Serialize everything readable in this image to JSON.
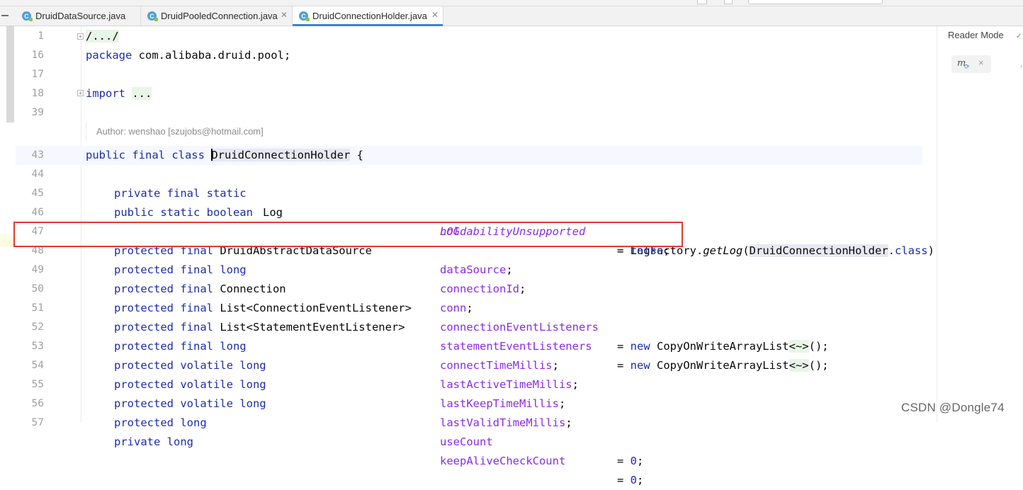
{
  "tabs": [
    {
      "label": "DruidDataSource.java",
      "icon": "java-class-icon",
      "active": false
    },
    {
      "label": "DruidPooledConnection.java",
      "icon": "java-class-icon",
      "active": false
    },
    {
      "label": "DruidConnectionHolder.java",
      "icon": "java-class-icon",
      "active": true
    }
  ],
  "reader_mode": "Reader Mode",
  "maven_widget": {
    "icon": "maven-sync-icon",
    "close": "×"
  },
  "author_hint": "Author: wenshao [szujobs@hotmail.com]",
  "line_numbers": [
    "1",
    "16",
    "17",
    "18",
    "39",
    "43",
    "44",
    "45",
    "46",
    "47",
    "48",
    "49",
    "50",
    "51",
    "52",
    "53",
    "54",
    "55",
    "56",
    "57"
  ],
  "code": {
    "l1": "/.../",
    "l16_kw": "package",
    "l16_rest": " com.alibaba.druid.pool;",
    "l18_kw": "import",
    "l18_fold": "...",
    "l43_kw": "public final class ",
    "l43_name": "DruidConnectionHolder",
    "l43_rest": " {",
    "l44_kw": "private final static ",
    "l44_type": "Log",
    "l44_field": "LOG",
    "l44_eq": "= LogFactory.",
    "l44_method": "getLog",
    "l44_open": "(",
    "l44_ref": "DruidConnectionHolder",
    "l44_dot": ".",
    "l44_class": "class",
    "l44_close": ");",
    "l45_kw": "public static boolean",
    "l45_field": "holdabilityUnsupported",
    "l45_eq": "= ",
    "l45_val": "false",
    "l45_end": ";",
    "l47_kw": "protected final ",
    "l47_type": "DruidAbstractDataSource",
    "l47_field": "dataSource",
    "l47_end": ";",
    "l48_kw": "protected final long",
    "l48_field": "connectionId",
    "l48_end": ";",
    "l49_kw": "protected final ",
    "l49_type": "Connection",
    "l49_field": "conn",
    "l49_end": ";",
    "l50_kw": "protected final ",
    "l50_type": "List<ConnectionEventListener>",
    "l50_field": "connectionEventListeners",
    "l50_eq": "= ",
    "l50_new": "new",
    "l50_ctor": " CopyOnWriteArrayList",
    "l50_gen": "<~>",
    "l50_end": "();",
    "l51_kw": "protected final ",
    "l51_type": "List<StatementEventListener>",
    "l51_field": "statementEventListeners",
    "l51_eq": "= ",
    "l51_new": "new",
    "l51_ctor": " CopyOnWriteArrayList",
    "l51_gen": "<~>",
    "l51_end": "();",
    "l52_kw": "protected final long",
    "l52_field": "connectTimeMillis",
    "l52_end": ";",
    "l53_kw": "protected volatile long",
    "l53_field": "lastActiveTimeMillis",
    "l53_end": ";",
    "l54_kw": "protected volatile long",
    "l54_field": "lastKeepTimeMillis",
    "l54_end": ";",
    "l55_kw": "protected volatile long",
    "l55_field": "lastValidTimeMillis",
    "l55_end": ";",
    "l56_kw": "protected long",
    "l56_field": "useCount",
    "l56_eq": "= ",
    "l56_num": "0",
    "l56_end": ";",
    "l57_kw": "private long",
    "l57_field": "keepAliveCheckCount",
    "l57_eq": "= ",
    "l57_num": "0",
    "l57_end": ";"
  },
  "watermark": "CSDN @Dongle74",
  "colors": {
    "keyword": "#1d2da8",
    "field": "#8a2be2",
    "highlight_box": "#e53935",
    "active_tab_underline": "#4083c9"
  }
}
